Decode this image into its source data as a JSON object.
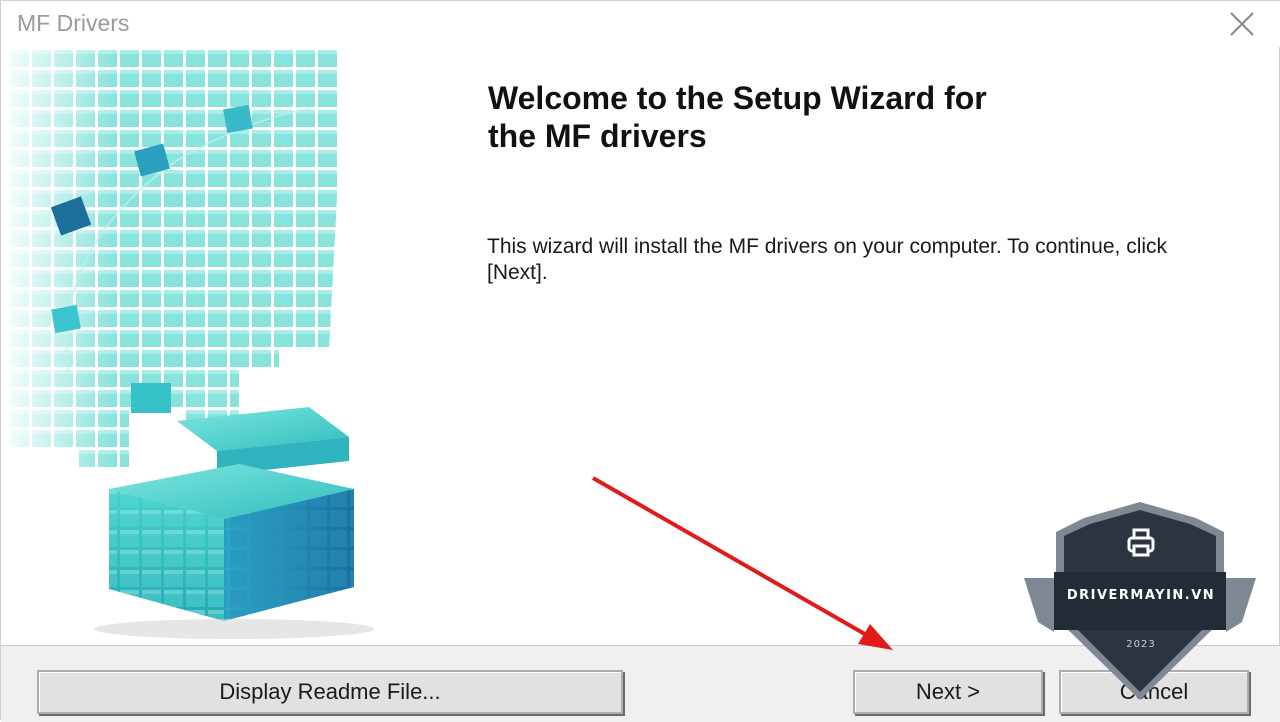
{
  "window": {
    "title": "MF Drivers",
    "close_icon": "close-icon"
  },
  "main": {
    "heading": "Welcome to the Setup Wizard for\nthe MF drivers",
    "body": "This wizard will install the MF drivers on your computer. To continue, click [Next]."
  },
  "buttons": {
    "readme": "Display Readme File...",
    "next": "Next >",
    "cancel": "Cancel"
  },
  "watermark": {
    "brand": "DRIVERMAYIN.VN",
    "year": "2023",
    "icon": "printer-icon"
  },
  "colors": {
    "art_teal": "#2ec8c8",
    "arrow": "#e11a1a",
    "badge": "#2b3440"
  }
}
